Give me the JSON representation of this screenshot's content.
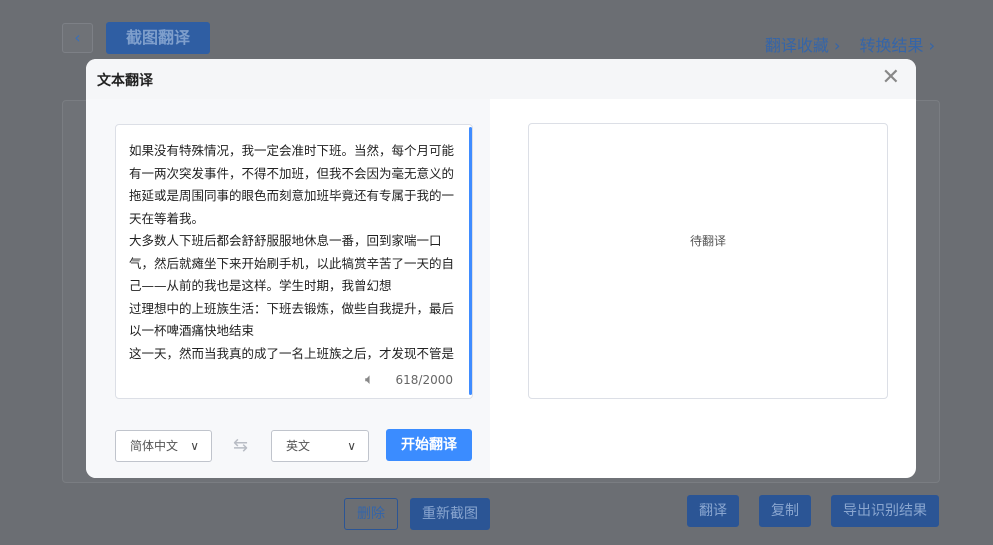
{
  "page": {
    "title": "截图翻译",
    "links": [
      "翻译收藏 ›",
      "转换结果 ›"
    ],
    "buttons": {
      "delete": "删除",
      "recapture": "重新截图",
      "translate": "翻译",
      "copy": "复制",
      "export": "导出识别结果"
    }
  },
  "modal": {
    "title": "文本翻译",
    "source_text": [
      "如果没有特殊情况，我一定会准时下班。当然，每个月可能有一两次突发事件，不得不加班，但我不会因为毫无意义的拖延或是周围同事的眼色而刻意加班毕竟还有专属于我的一天在等着我。",
      "大多数人下班后都会舒舒服服地休息一番，回到家喘一口气，然后就瘫坐下来开始刷手机，以此犒赏辛苦了一天的自己——从前的我也是这样。学生时期，我曾幻想",
      "过理想中的上班族生活：下班去锻炼，做些自我提升，最后以一杯啤酒痛快地结束",
      "这一天，然而当我真的成了一名上班族之后，才发现不管是"
    ],
    "char_count": "618/2000",
    "source_lang": "简体中文",
    "target_lang": "英文",
    "start_label": "开始翻译",
    "result_placeholder": "待翻译"
  }
}
